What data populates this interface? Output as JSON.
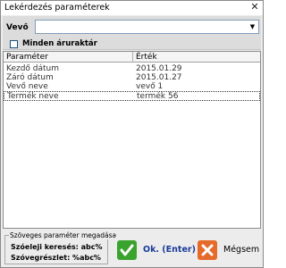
{
  "window": {
    "title": "Lekérdezés paraméterek",
    "close_glyph": "✕"
  },
  "filter": {
    "vevo_label": "Vevő",
    "vevo_value": "",
    "all_warehouses_label": "Minden áruraktár",
    "all_warehouses_checked": false
  },
  "grid": {
    "columns": [
      "Paraméter",
      "Érték"
    ],
    "rows": [
      {
        "param": "Kezdő dátum",
        "value": "2015.01.29"
      },
      {
        "param": "Záró dátum",
        "value": "2015.01.27"
      },
      {
        "param": "Vevő neve",
        "value": "vevő 1"
      },
      {
        "param": "Termék neve",
        "value": "termék 56"
      }
    ],
    "selected_row": 3
  },
  "hint": {
    "title": "Szöveges paraméter megadása",
    "line1": "Szóeleji keresés:  abc%",
    "line2": "Szóvegrészlet:  %abc%"
  },
  "buttons": {
    "ok_label": "Ok. (Enter)",
    "cancel_label": "Mégsem"
  },
  "colors": {
    "ok_icon": "#3aa32e",
    "cancel_icon": "#e66a2a",
    "ok_text": "#1a3a9a"
  }
}
